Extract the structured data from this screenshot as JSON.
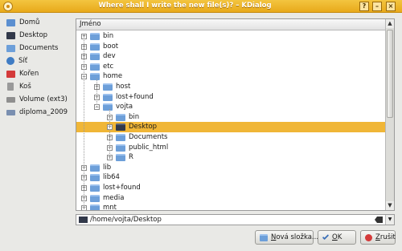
{
  "window": {
    "title": "Where shall I write the new file(s)? – KDialog"
  },
  "titlebar_buttons": {
    "help": "?",
    "minimize": "–",
    "close": "×"
  },
  "sidebar": {
    "items": [
      {
        "label": "Domů",
        "icon": "home-icon",
        "color": "#5b8fd0"
      },
      {
        "label": "Desktop",
        "icon": "desktop-icon",
        "color": "#32394a"
      },
      {
        "label": "Documents",
        "icon": "documents-folder-icon",
        "color": "#6d9fd9"
      },
      {
        "label": "Síť",
        "icon": "network-icon",
        "color": "#3f7cc4"
      },
      {
        "label": "Kořen",
        "icon": "root-folder-icon",
        "color": "#d43a3a"
      },
      {
        "label": "Koš",
        "icon": "trash-icon",
        "color": "#9a9a9a"
      },
      {
        "label": "Volume (ext3)",
        "icon": "drive-icon",
        "color": "#8f8f8f"
      },
      {
        "label": "diploma_2009",
        "icon": "removable-drive-icon",
        "color": "#7a8fb0"
      }
    ]
  },
  "tree": {
    "header": "Jméno",
    "rows": [
      {
        "label": "bin",
        "depth": 0,
        "expander": "+"
      },
      {
        "label": "boot",
        "depth": 0,
        "expander": "+"
      },
      {
        "label": "dev",
        "depth": 0,
        "expander": "+"
      },
      {
        "label": "etc",
        "depth": 0,
        "expander": "+"
      },
      {
        "label": "home",
        "depth": 0,
        "expander": "−"
      },
      {
        "label": "host",
        "depth": 1,
        "expander": "+"
      },
      {
        "label": "lost+found",
        "depth": 1,
        "expander": "+"
      },
      {
        "label": "vojta",
        "depth": 1,
        "expander": "−"
      },
      {
        "label": "bin",
        "depth": 2,
        "expander": "+"
      },
      {
        "label": "Desktop",
        "depth": 2,
        "expander": "+",
        "selected": true
      },
      {
        "label": "Documents",
        "depth": 2,
        "expander": "+"
      },
      {
        "label": "public_html",
        "depth": 2,
        "expander": "+"
      },
      {
        "label": "R",
        "depth": 2,
        "expander": "+"
      },
      {
        "label": "lib",
        "depth": 0,
        "expander": "+"
      },
      {
        "label": "lib64",
        "depth": 0,
        "expander": "+"
      },
      {
        "label": "lost+found",
        "depth": 0,
        "expander": "+"
      },
      {
        "label": "media",
        "depth": 0,
        "expander": "+"
      },
      {
        "label": "mnt",
        "depth": 0,
        "expander": "+"
      }
    ]
  },
  "path": {
    "value": "/home/vojta/Desktop"
  },
  "buttons": {
    "new_folder": {
      "prefix": "",
      "accel": "N",
      "rest": "ová složka..."
    },
    "ok": {
      "prefix": "",
      "accel": "O",
      "rest": "K"
    },
    "cancel": {
      "prefix": "",
      "accel": "Z",
      "rest": "rušit"
    }
  },
  "colors": {
    "titlebar": "#f0b637",
    "selection": "#f0b637"
  }
}
